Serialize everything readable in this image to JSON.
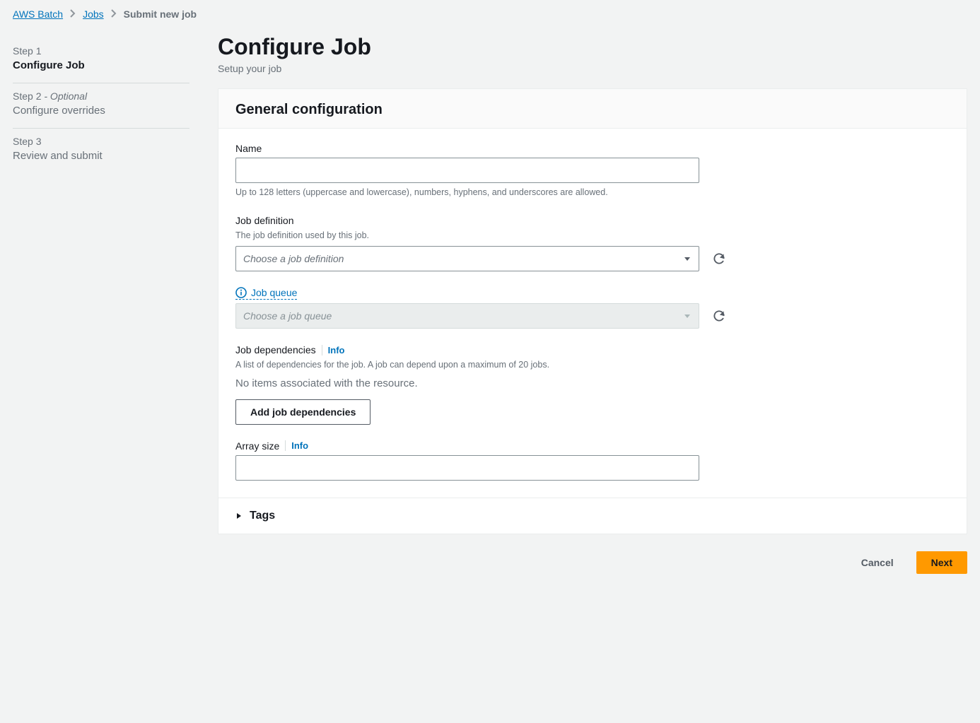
{
  "breadcrumb": {
    "items": [
      "AWS Batch",
      "Jobs"
    ],
    "current": "Submit new job"
  },
  "steps": [
    {
      "num": "Step 1",
      "optional": "",
      "title": "Configure Job",
      "active": true
    },
    {
      "num": "Step 2",
      "optional": " - Optional",
      "title": "Configure overrides",
      "active": false
    },
    {
      "num": "Step 3",
      "optional": "",
      "title": "Review and submit",
      "active": false
    }
  ],
  "header": {
    "title": "Configure Job",
    "subtitle": "Setup your job"
  },
  "panel": {
    "title": "General configuration",
    "name": {
      "label": "Name",
      "hint": "Up to 128 letters (uppercase and lowercase), numbers, hyphens, and underscores are allowed."
    },
    "jobdef": {
      "label": "Job definition",
      "hint": "The job definition used by this job.",
      "placeholder": "Choose a job definition"
    },
    "jobqueue": {
      "label": "Job queue",
      "placeholder": "Choose a job queue"
    },
    "deps": {
      "label": "Job dependencies",
      "info": "Info",
      "hint": "A list of dependencies for the job. A job can depend upon a maximum of 20 jobs.",
      "empty": "No items associated with the resource.",
      "add": "Add job dependencies"
    },
    "arraysize": {
      "label": "Array size",
      "info": "Info"
    },
    "tags": {
      "label": "Tags"
    }
  },
  "footer": {
    "cancel": "Cancel",
    "next": "Next"
  }
}
